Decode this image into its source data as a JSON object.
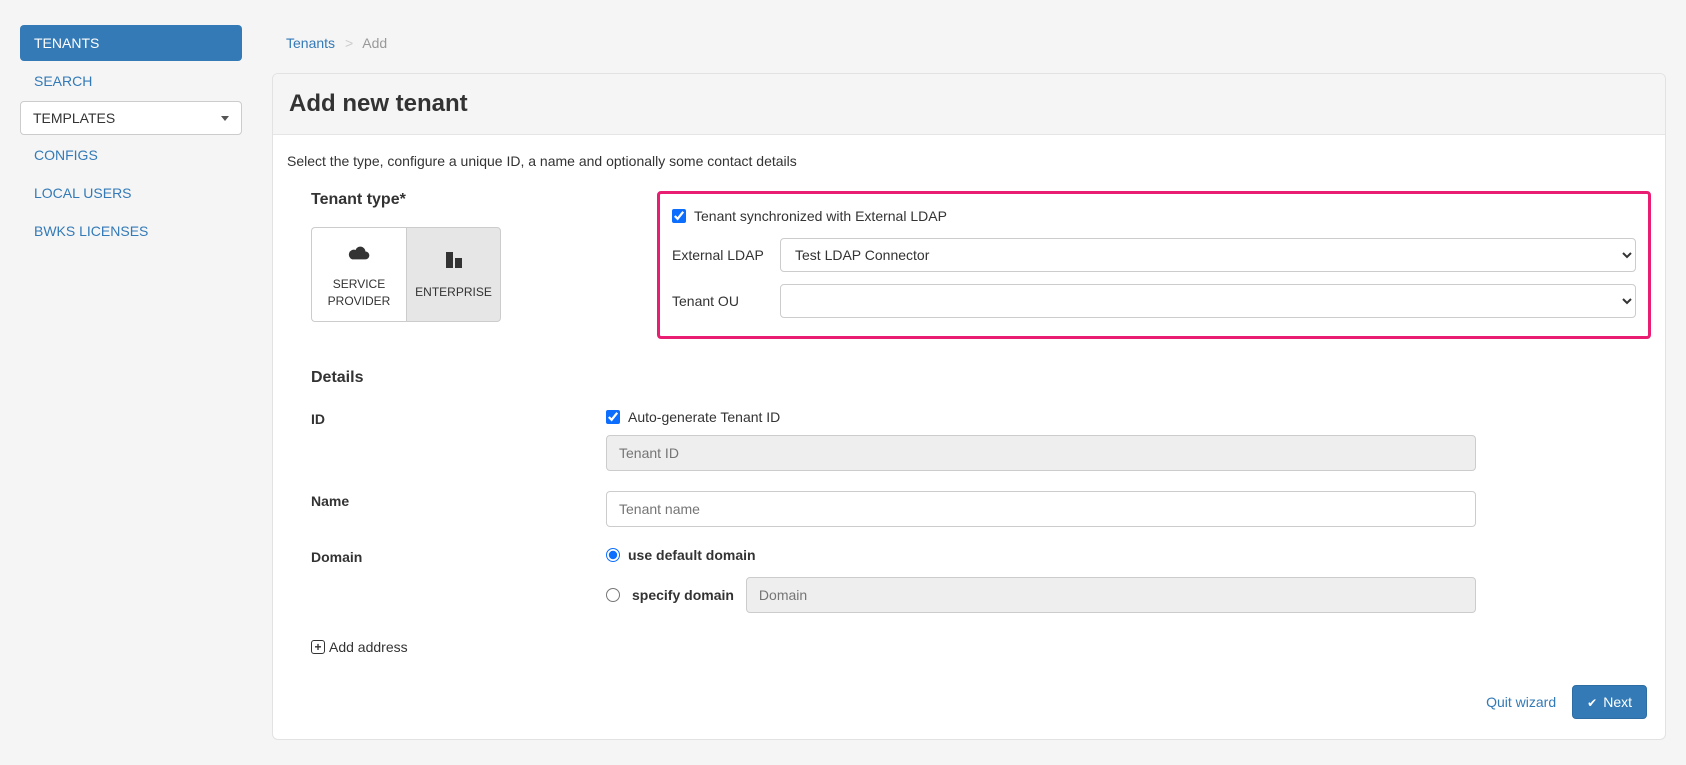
{
  "sidebar": {
    "items": [
      {
        "label": "TENANTS",
        "active": true
      },
      {
        "label": "SEARCH",
        "active": false
      },
      {
        "label": "TEMPLATES",
        "dropdown": true
      },
      {
        "label": "CONFIGS",
        "active": false
      },
      {
        "label": "LOCAL USERS",
        "active": false
      },
      {
        "label": "BWKS LICENSES",
        "active": false
      }
    ]
  },
  "breadcrumb": {
    "parent": "Tenants",
    "current": "Add"
  },
  "page": {
    "title": "Add new tenant",
    "instruction": "Select the type, configure a unique ID, a name and optionally some contact details"
  },
  "tenant_type": {
    "heading": "Tenant type*",
    "options": [
      {
        "label": "SERVICE PROVIDER",
        "icon": "cloud",
        "selected": false
      },
      {
        "label": "ENTERPRISE",
        "icon": "building",
        "selected": true
      }
    ]
  },
  "ldap": {
    "checkbox_label": "Tenant synchronized with External LDAP",
    "checked": true,
    "external_label": "External LDAP",
    "external_value": "Test LDAP Connector",
    "ou_label": "Tenant OU",
    "ou_value": ""
  },
  "details": {
    "heading": "Details",
    "id_label": "ID",
    "autogen_label": "Auto-generate Tenant ID",
    "autogen_checked": true,
    "id_placeholder": "Tenant ID",
    "name_label": "Name",
    "name_placeholder": "Tenant name",
    "domain_label": "Domain",
    "domain_default_label": "use default domain",
    "domain_specify_label": "specify domain",
    "domain_placeholder": "Domain",
    "add_address_label": "Add address"
  },
  "footer": {
    "quit": "Quit wizard",
    "next": "Next"
  }
}
